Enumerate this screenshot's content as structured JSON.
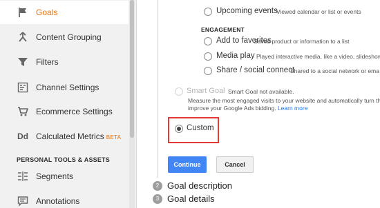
{
  "sidebar": {
    "items": [
      {
        "label": "Goals",
        "icon": "flag-icon",
        "active": true
      },
      {
        "label": "Content Grouping",
        "icon": "content-grouping-icon"
      },
      {
        "label": "Filters",
        "icon": "filter-icon"
      },
      {
        "label": "Channel Settings",
        "icon": "channel-settings-icon"
      },
      {
        "label": "Ecommerce Settings",
        "icon": "cart-icon"
      },
      {
        "label": "Calculated Metrics",
        "icon": "dd-icon",
        "icon_text": "Dd",
        "badge": "BETA"
      }
    ],
    "section_header": "PERSONAL TOOLS & ASSETS",
    "personal_items": [
      {
        "label": "Segments",
        "icon": "segments-icon"
      },
      {
        "label": "Annotations",
        "icon": "annotations-icon"
      }
    ]
  },
  "goal_options": {
    "upcoming": {
      "label": "Upcoming events",
      "desc": "Viewed calendar or list or events"
    },
    "engagement_title": "ENGAGEMENT",
    "engagement": [
      {
        "label": "Add to favorites",
        "desc": "Saved product or information to a list"
      },
      {
        "label": "Media play",
        "desc": "Played interactive media, like a video, slideshow,"
      },
      {
        "label": "Share / social connect",
        "desc": "Shared to a social network or ema"
      }
    ],
    "smart_goal": {
      "label": "Smart Goal",
      "status": "Smart Goal not available.",
      "text_line1": "Measure the most engaged visits to your website and automatically turn the",
      "text_line2": "improve your Google Ads bidding.",
      "link": "Learn more"
    },
    "custom": {
      "label": "Custom",
      "selected": true
    }
  },
  "buttons": {
    "continue": "Continue",
    "cancel": "Cancel"
  },
  "steps": [
    {
      "num": "2",
      "label": "Goal description"
    },
    {
      "num": "3",
      "label": "Goal details"
    }
  ],
  "colors": {
    "accent": "#e8710a",
    "primary_button": "#4285f4",
    "highlight_box": "#e53935",
    "link": "#1a73e8"
  }
}
